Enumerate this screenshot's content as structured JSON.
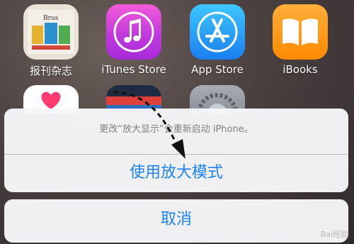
{
  "home_screen": {
    "apps": [
      {
        "label": "报刊杂志",
        "icon": "newsstand-icon"
      },
      {
        "label": "iTunes Store",
        "icon": "itunes-store-icon"
      },
      {
        "label": "App Store",
        "icon": "app-store-icon"
      },
      {
        "label": "iBooks",
        "icon": "ibooks-icon"
      }
    ],
    "row2_icons": [
      "health-icon",
      "passbook-icon",
      "settings-icon"
    ],
    "newsstand_tile_text": "Brus"
  },
  "action_sheet": {
    "message": "更改“放大显示”会重新启动 iPhone。",
    "confirm_label": "使用放大模式",
    "cancel_label": "取消",
    "accent_color": "#1b83f2"
  },
  "watermark": "Bai经验"
}
